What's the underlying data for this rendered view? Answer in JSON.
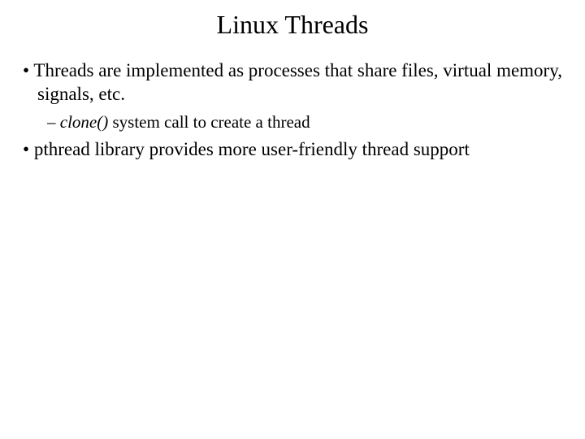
{
  "slide": {
    "title": "Linux Threads",
    "bullet1": "Threads are implemented as processes that share files, virtual memory, signals, etc.",
    "sub1_code": "clone()",
    "sub1_rest": " system call to create a thread",
    "bullet2": "pthread library provides more user-friendly thread support"
  }
}
